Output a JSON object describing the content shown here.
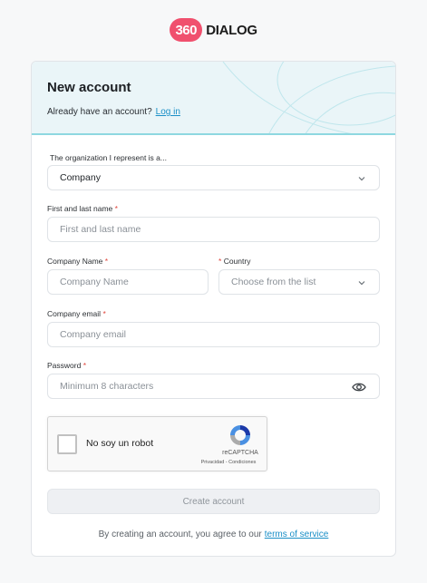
{
  "logo": {
    "badge": "360",
    "text": "DIALOG"
  },
  "header": {
    "title": "New account",
    "login_prompt": "Already have an account?",
    "login_link": "Log in"
  },
  "form": {
    "org_type": {
      "label": "The organization I represent is a...",
      "value": "Company"
    },
    "name": {
      "label": "First and last name",
      "required_mark": "*",
      "placeholder": "First and last name"
    },
    "company_name": {
      "label": "Company Name",
      "required_mark": "*",
      "placeholder": "Company Name"
    },
    "country": {
      "required_mark": "*",
      "label": "Country",
      "placeholder": "Choose from the list"
    },
    "company_email": {
      "label": "Company email",
      "required_mark": "*",
      "placeholder": "Company email"
    },
    "password": {
      "label": "Password",
      "required_mark": "*",
      "placeholder": "Minimum 8 characters"
    }
  },
  "captcha": {
    "label": "No soy un robot",
    "brand": "reCAPTCHA",
    "links": "Privacidad - Condiciones"
  },
  "submit_label": "Create account",
  "terms": {
    "text": "By creating an account, you agree to our",
    "link": "terms of service"
  },
  "colors": {
    "brand": "#f0506e",
    "link": "#1a8fc7",
    "header_bg": "#eaf5f8",
    "header_accent": "#8ed8e0",
    "required": "#e0453c"
  }
}
